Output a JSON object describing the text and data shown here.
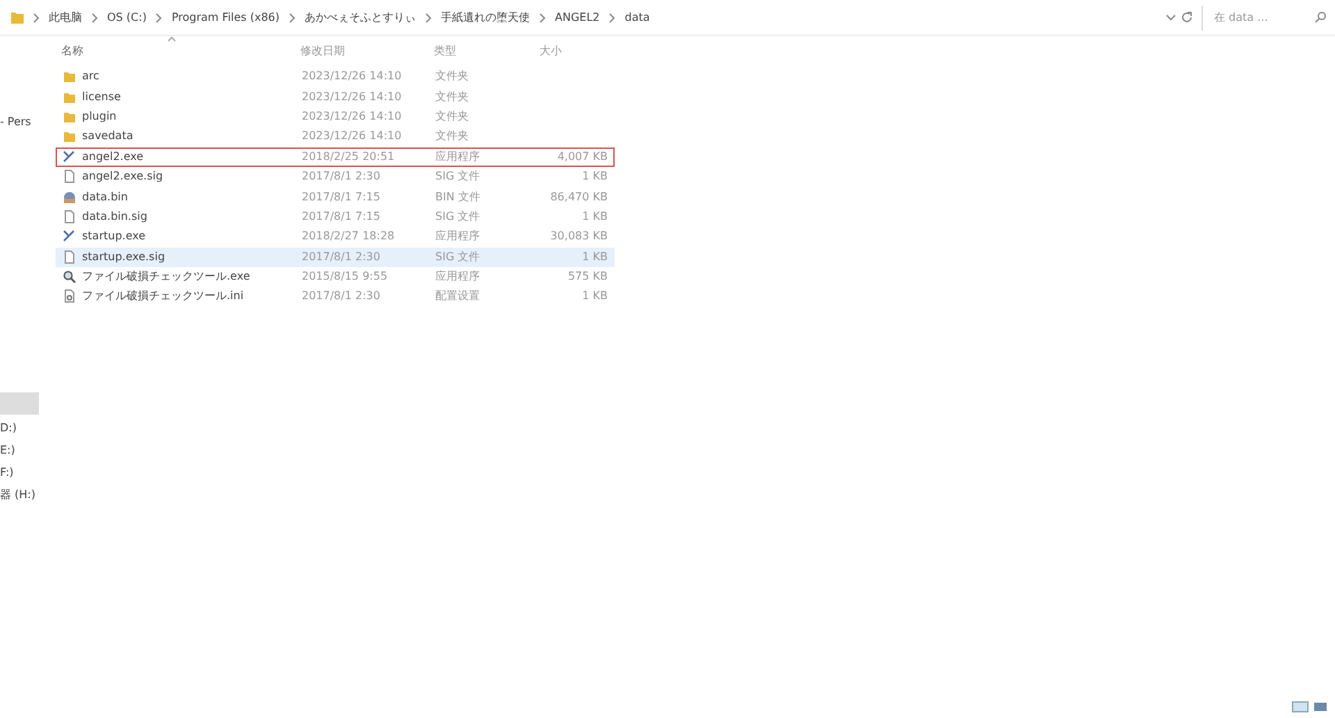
{
  "address_bar": {
    "crumbs": [
      "此电脑",
      "OS (C:)",
      "Program Files (x86)",
      "あかべぇそふとすりぃ",
      "手紙遺れの堕天使",
      "ANGEL2",
      "data"
    ]
  },
  "search": {
    "placeholder": "在 data ..."
  },
  "sidebar": {
    "items": [
      {
        "label": "- Pers",
        "selected": false
      },
      {
        "selected": true
      },
      {
        "label": "D:)",
        "selected": false
      },
      {
        "label": "E:)",
        "selected": false
      },
      {
        "label": "F:)",
        "selected": false
      },
      {
        "label": "器 (H:)",
        "selected": false
      }
    ]
  },
  "table": {
    "columns": [
      "名称",
      "修改日期",
      "类型",
      "大小"
    ],
    "rows": [
      {
        "kind": "folder",
        "name": "arc",
        "date": "2023/12/26 14:10",
        "type": "文件夹",
        "selected": false,
        "outlined": false
      },
      {
        "kind": "folder",
        "name": "license",
        "date": "2023/12/26 14:10",
        "type": "文件夹",
        "selected": false,
        "outlined": false
      },
      {
        "kind": "folder",
        "name": "plugin",
        "date": "2023/12/26 14:10",
        "type": "文件夹",
        "selected": false,
        "outlined": false
      },
      {
        "kind": "folder",
        "name": "savedata",
        "date": "2023/12/26 14:10",
        "type": "文件夹",
        "selected": false,
        "outlined": false
      },
      {
        "kind": "app",
        "name": "angel2.exe",
        "date": "2018/2/25 20:51",
        "type": "应用程序",
        "size": "4,007 KB",
        "selected": false,
        "outlined": true
      },
      {
        "kind": "file",
        "name": "angel2.exe.sig",
        "date": "2017/8/1 2:30",
        "type": "SIG 文件",
        "size": "1 KB",
        "selected": false,
        "outlined": false
      },
      {
        "kind": "bin",
        "name": "data.bin",
        "date": "2017/8/1 7:15",
        "type": "BIN 文件",
        "size": "86,470 KB",
        "selected": false,
        "outlined": false
      },
      {
        "kind": "file",
        "name": "data.bin.sig",
        "date": "2017/8/1 7:15",
        "type": "SIG 文件",
        "size": "1 KB",
        "selected": false,
        "outlined": false
      },
      {
        "kind": "app",
        "name": "startup.exe",
        "date": "2018/2/27 18:28",
        "type": "应用程序",
        "size": "30,083 KB",
        "selected": false,
        "outlined": false
      },
      {
        "kind": "file",
        "name": "startup.exe.sig",
        "date": "2017/8/1 2:30",
        "type": "SIG 文件",
        "size": "1 KB",
        "selected": true,
        "outlined": false
      },
      {
        "kind": "tool",
        "name": "ファイル破損チェックツール.exe",
        "date": "2015/8/15 9:55",
        "type": "应用程序",
        "size": "575 KB",
        "selected": false,
        "outlined": false
      },
      {
        "kind": "config",
        "name": "ファイル破損チェックツール.ini",
        "date": "2017/8/1 2:30",
        "type": "配置设置",
        "size": "1 KB",
        "selected": false,
        "outlined": false
      }
    ]
  }
}
